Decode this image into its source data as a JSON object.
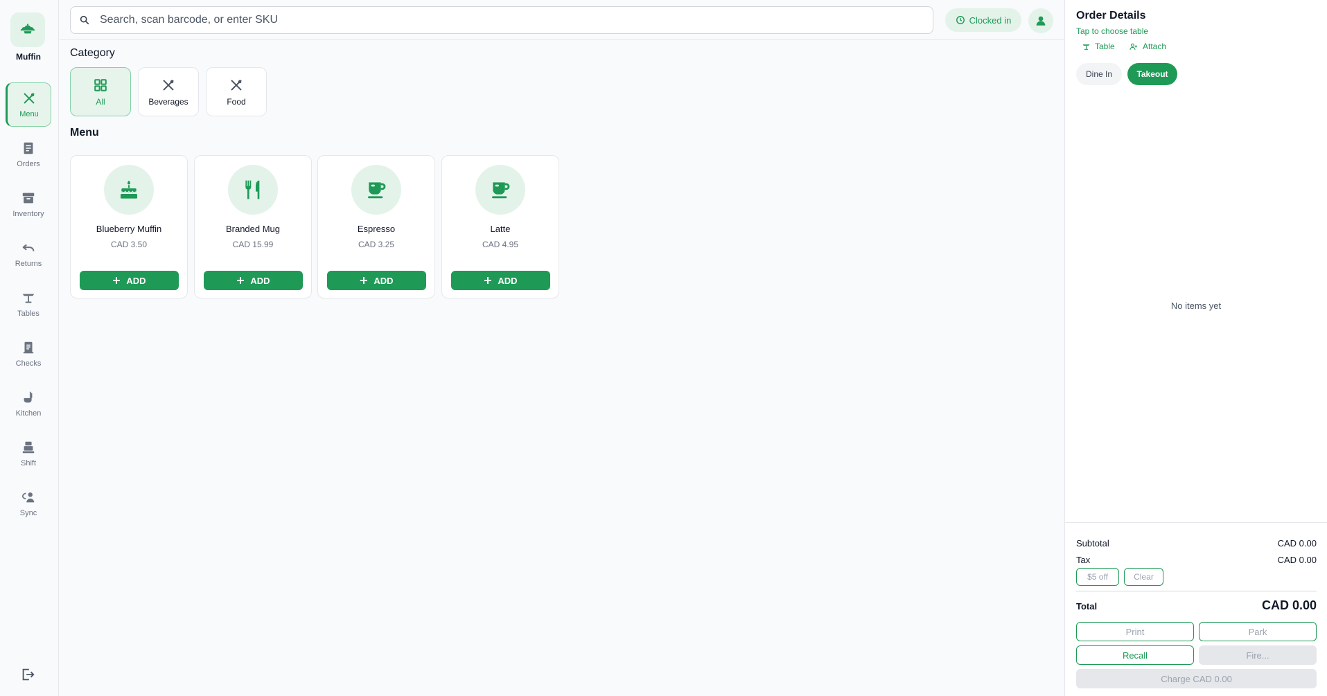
{
  "brand": {
    "name": "Muffin",
    "logo_icon": "sprout-icon"
  },
  "sidebar": {
    "items": [
      {
        "label": "Menu",
        "icon": "utensils-icon",
        "active": true
      },
      {
        "label": "Orders",
        "icon": "receipt-icon"
      },
      {
        "label": "Inventory",
        "icon": "archive-box-icon"
      },
      {
        "label": "Returns",
        "icon": "undo-icon"
      },
      {
        "label": "Tables",
        "icon": "table-icon"
      },
      {
        "label": "Checks",
        "icon": "check-receipt-icon"
      },
      {
        "label": "Kitchen",
        "icon": "kitchen-icon"
      },
      {
        "label": "Shift",
        "icon": "cash-register-icon"
      },
      {
        "label": "Sync",
        "icon": "sync-icon"
      }
    ],
    "logout_icon": "logout-icon"
  },
  "search": {
    "placeholder": "Search, scan barcode, or enter SKU",
    "value": ""
  },
  "header": {
    "clock_label": "Clocked in"
  },
  "categories": {
    "title": "Category",
    "items": [
      {
        "label": "All",
        "icon": "grid-icon",
        "active": true
      },
      {
        "label": "Beverages",
        "icon": "utensils-icon"
      },
      {
        "label": "Food",
        "icon": "utensils-icon"
      }
    ]
  },
  "menu": {
    "title": "Menu",
    "add_label": "ADD",
    "items": [
      {
        "name": "Blueberry Muffin",
        "price": "CAD 3.50",
        "icon": "cake-icon"
      },
      {
        "name": "Branded Mug",
        "price": "CAD 15.99",
        "icon": "fork-knife-icon"
      },
      {
        "name": "Espresso",
        "price": "CAD 3.25",
        "icon": "coffee-cup-icon"
      },
      {
        "name": "Latte",
        "price": "CAD 4.95",
        "icon": "coffee-cup-icon"
      }
    ]
  },
  "order": {
    "title": "Order Details",
    "subtitle": "Tap to choose table",
    "table_label": "Table",
    "attach_label": "Attach",
    "dine_in": "Dine In",
    "takeout": "Takeout",
    "empty": "No items yet",
    "subtotal_label": "Subtotal",
    "subtotal": "CAD 0.00",
    "tax_label": "Tax",
    "tax": "CAD 0.00",
    "discount_label": "$5 off",
    "clear_label": "Clear",
    "total_label": "Total",
    "total": "CAD 0.00",
    "print_label": "Print",
    "park_label": "Park",
    "recall_label": "Recall",
    "fire_label": "Fire...",
    "charge_label": "Charge CAD 0.00"
  },
  "colors": {
    "accent": "#1e9a56",
    "accent_soft": "#e3f3ea",
    "border": "#e5e7eb"
  }
}
